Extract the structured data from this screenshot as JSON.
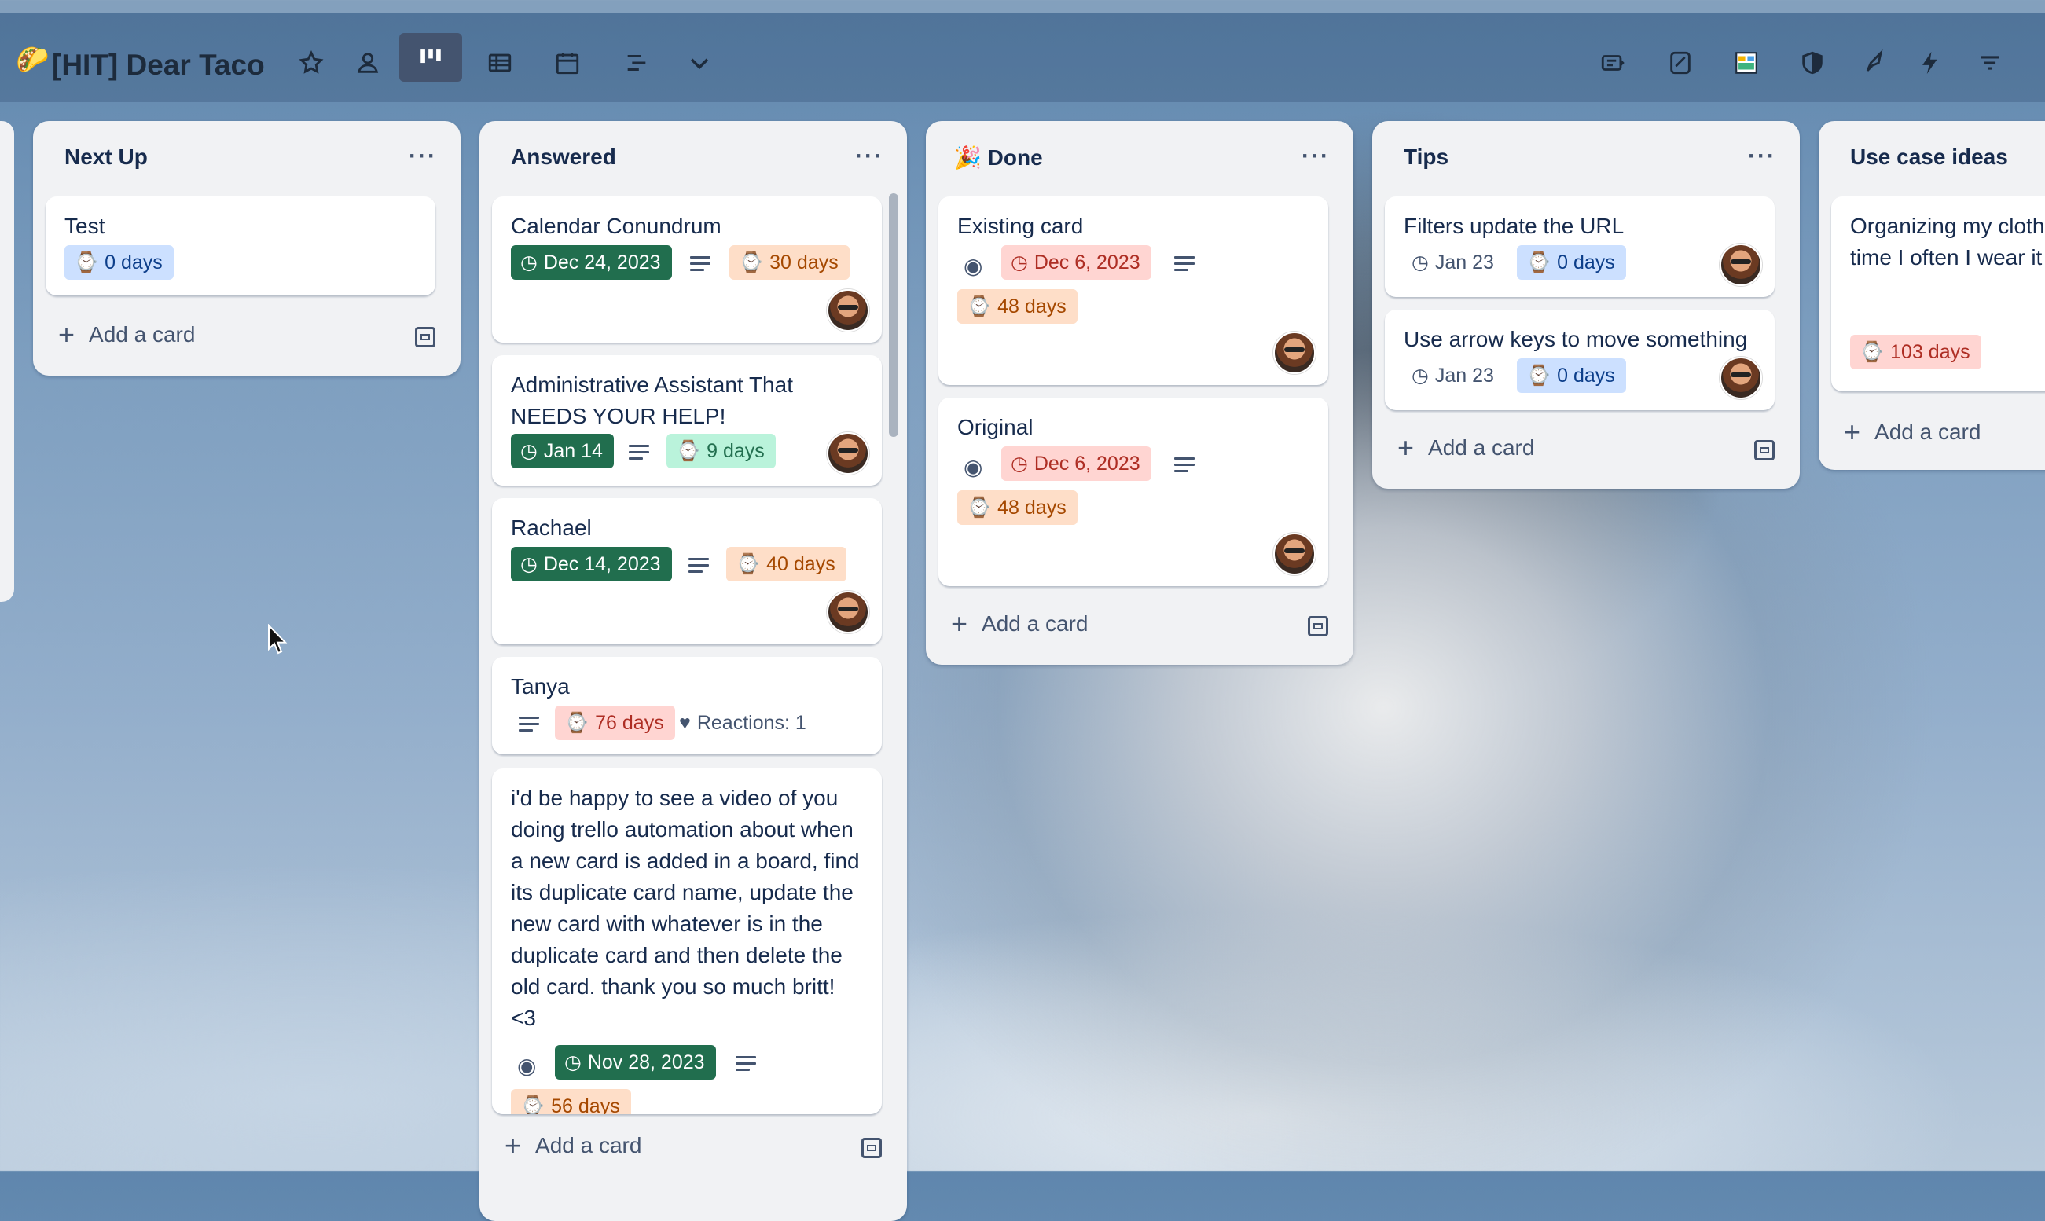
{
  "board": {
    "title": "[HIT] Dear Taco",
    "icons": [
      "taco-emoji",
      "star-icon",
      "members-icon",
      "board-view-icon",
      "table-view-icon",
      "calendar-view-icon",
      "timeline-view-icon",
      "chevron-down-icon",
      "card-icon",
      "eraser-icon",
      "planner-icon",
      "shield-icon",
      "rocket-icon",
      "lightning-icon",
      "filter-icon"
    ]
  },
  "lists": [
    {
      "name": "Next Up",
      "menu": "···",
      "add_card": "Add a card",
      "cards": [
        {
          "title": "Test",
          "badges": [
            {
              "text": "0 days",
              "style": "blue"
            }
          ]
        }
      ]
    },
    {
      "name": "Answered",
      "menu": "···",
      "add_card": "Add a card",
      "cards": [
        {
          "title": "Calendar Conundrum",
          "badges": [
            {
              "text": "Dec 24, 2023",
              "style": "green"
            },
            {
              "text": "30 days",
              "style": "orange"
            }
          ]
        },
        {
          "title": "Administrative Assistant That NEEDS YOUR HELP!",
          "badges": [
            {
              "text": "Jan 14",
              "style": "green"
            },
            {
              "text": "9 days",
              "style": "light-green"
            }
          ]
        },
        {
          "title": "Rachael",
          "badges": [
            {
              "text": "Dec 14, 2023",
              "style": "green"
            },
            {
              "text": "40 days",
              "style": "orange"
            }
          ]
        },
        {
          "title": "Tanya",
          "badges": [
            {
              "text": "76 days",
              "style": "red"
            },
            {
              "text": "Reactions: 1",
              "style": "plain"
            }
          ]
        },
        {
          "title": "i'd be happy to see a video of you doing trello automation about when a new card is added in a board, find its duplicate card name, update the new card with whatever is in the duplicate card and then delete the old card. thank you so much britt! <3",
          "badges": [
            {
              "text": "Nov 28, 2023",
              "style": "green"
            },
            {
              "text": "56 days",
              "style": "orange"
            }
          ]
        }
      ]
    },
    {
      "name": "Done",
      "emoji": "🎉",
      "menu": "···",
      "add_card": "Add a card",
      "cards": [
        {
          "title": "Existing card",
          "badges": [
            {
              "text": "Dec 6, 2023",
              "style": "red"
            },
            {
              "text": "48 days",
              "style": "orange"
            }
          ]
        },
        {
          "title": "Original",
          "badges": [
            {
              "text": "Dec 6, 2023",
              "style": "red"
            },
            {
              "text": "48 days",
              "style": "orange"
            }
          ]
        }
      ]
    },
    {
      "name": "Tips",
      "menu": "···",
      "add_card": "Add a card",
      "cards": [
        {
          "title": "Filters update the URL",
          "badges": [
            {
              "text": "Jan 23",
              "style": "plain"
            },
            {
              "text": "0 days",
              "style": "blue"
            }
          ]
        },
        {
          "title": "Use arrow keys to move something",
          "badges": [
            {
              "text": "Jan 23",
              "style": "plain"
            },
            {
              "text": "0 days",
              "style": "blue"
            }
          ]
        }
      ]
    },
    {
      "name": "Use case ideas",
      "add_card": "Add a card",
      "cards": [
        {
          "title": "Organizing my clothes - track the last time I often I wear it to track wear",
          "badges": [
            {
              "text": "103 days",
              "style": "red"
            }
          ]
        }
      ]
    }
  ],
  "colors": {
    "green": "#216e4e",
    "red_bg": "#ffd5d2",
    "orange_bg": "#fedec8",
    "blue_bg": "#cce0ff",
    "list_bg": "#f1f2f4"
  }
}
